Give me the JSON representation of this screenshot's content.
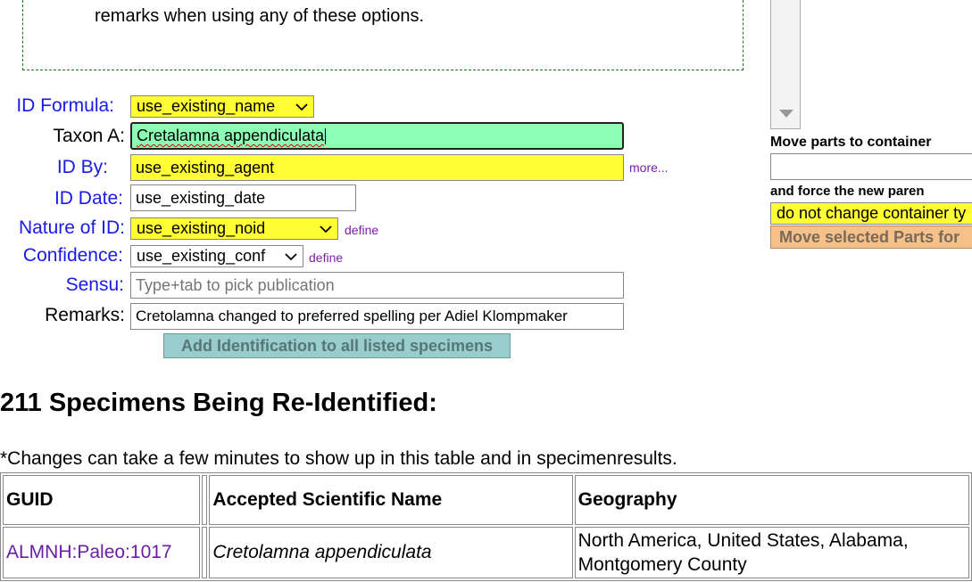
{
  "instructions": {
    "partial_line": "remarks when using any of these options."
  },
  "form": {
    "id_formula": {
      "label": "ID Formula:",
      "value": "use_existing_name"
    },
    "taxon_a": {
      "label": "Taxon A:",
      "value": "Cretalamna appendiculata"
    },
    "id_by": {
      "label": "ID By:",
      "value": "use_existing_agent",
      "more_link": "more..."
    },
    "id_date": {
      "label": "ID Date:",
      "value": "use_existing_date"
    },
    "nature_of_id": {
      "label": "Nature of ID:",
      "value": "use_existing_noid",
      "define_link": "define"
    },
    "confidence": {
      "label": "Confidence:",
      "value": "use_existing_conf",
      "define_link": "define"
    },
    "sensu": {
      "label": "Sensu:",
      "placeholder": "Type+tab to pick publication"
    },
    "remarks": {
      "label": "Remarks:",
      "value": "Cretolamna changed to preferred spelling per Adiel Klompmaker"
    },
    "add_button": "Add Identification to all listed specimens"
  },
  "right_panel": {
    "move_label": "Move parts to container",
    "force_label": "and force the new paren",
    "container_type_select": "do not change container ty",
    "move_button": "Move selected Parts for"
  },
  "results": {
    "heading": "211 Specimens Being Re-Identified:",
    "note": "*Changes can take a few minutes to show up in this table and in specimenresults.",
    "columns": [
      "GUID",
      "",
      "Accepted Scientific Name",
      "Geography"
    ],
    "rows": [
      {
        "guid": "ALMNH:Paleo:1017",
        "blank": "",
        "name": "Cretolamna appendiculata",
        "geography": "North America, United States, Alabama, Montgomery County"
      }
    ]
  }
}
